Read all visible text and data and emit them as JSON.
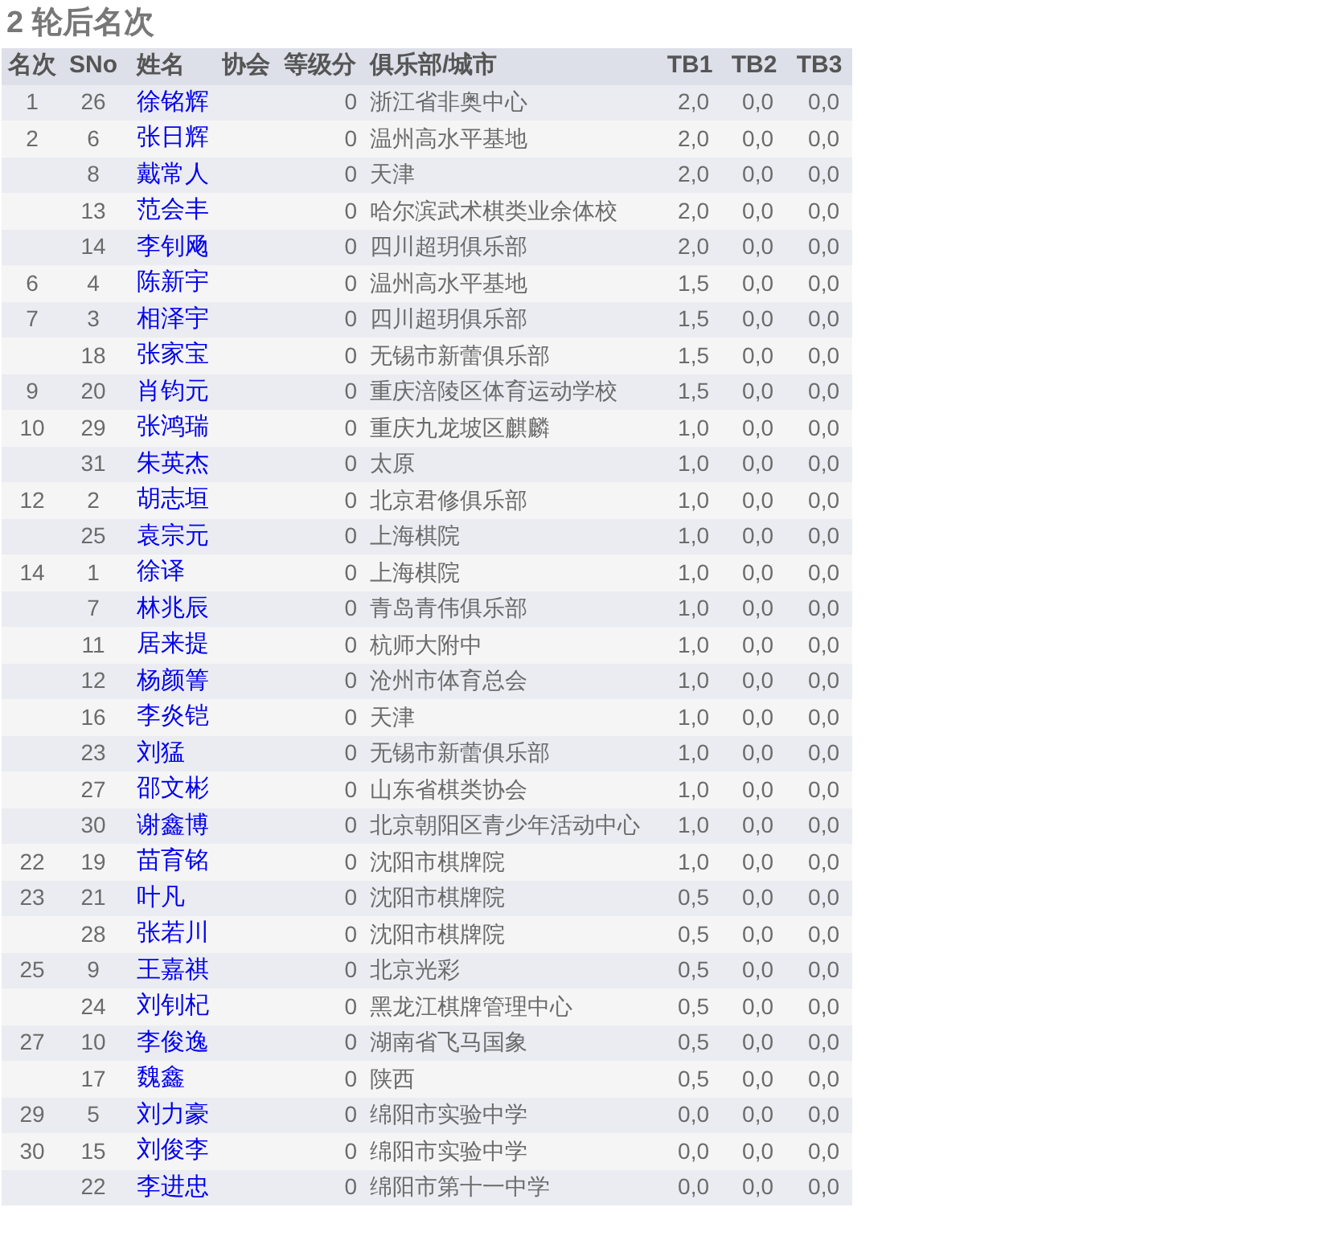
{
  "title": "2 轮后名次",
  "columns": [
    "名次",
    "SNo",
    "姓名",
    "协会",
    "等级分",
    "俱乐部/城市",
    "TB1",
    "TB2",
    "TB3"
  ],
  "rows": [
    {
      "rank": "1",
      "sno": "26",
      "name": "徐铭辉",
      "rating": "0",
      "club": "浙江省非奥中心",
      "tb1": "2,0",
      "tb2": "0,0",
      "tb3": "0,0"
    },
    {
      "rank": "2",
      "sno": "6",
      "name": "张日辉",
      "rating": "0",
      "club": "温州高水平基地",
      "tb1": "2,0",
      "tb2": "0,0",
      "tb3": "0,0"
    },
    {
      "sno": "8",
      "name": "戴常人",
      "rating": "0",
      "club": "天津",
      "tb1": "2,0",
      "tb2": "0,0",
      "tb3": "0,0"
    },
    {
      "sno": "13",
      "name": "范会丰",
      "rating": "0",
      "club": "哈尔滨武术棋类业余体校",
      "tb1": "2,0",
      "tb2": "0,0",
      "tb3": "0,0"
    },
    {
      "sno": "14",
      "name": "李钊飏",
      "rating": "0",
      "club": "四川超玥俱乐部",
      "tb1": "2,0",
      "tb2": "0,0",
      "tb3": "0,0"
    },
    {
      "rank": "6",
      "sno": "4",
      "name": "陈新宇",
      "rating": "0",
      "club": "温州高水平基地",
      "tb1": "1,5",
      "tb2": "0,0",
      "tb3": "0,0"
    },
    {
      "rank": "7",
      "sno": "3",
      "name": "相泽宇",
      "rating": "0",
      "club": "四川超玥俱乐部",
      "tb1": "1,5",
      "tb2": "0,0",
      "tb3": "0,0"
    },
    {
      "sno": "18",
      "name": "张家宝",
      "rating": "0",
      "club": "无锡市新蕾俱乐部",
      "tb1": "1,5",
      "tb2": "0,0",
      "tb3": "0,0"
    },
    {
      "rank": "9",
      "sno": "20",
      "name": "肖钧元",
      "rating": "0",
      "club": "重庆涪陵区体育运动学校",
      "tb1": "1,5",
      "tb2": "0,0",
      "tb3": "0,0"
    },
    {
      "rank": "10",
      "sno": "29",
      "name": "张鸿瑞",
      "rating": "0",
      "club": "重庆九龙坡区麒麟",
      "tb1": "1,0",
      "tb2": "0,0",
      "tb3": "0,0"
    },
    {
      "sno": "31",
      "name": "朱英杰",
      "rating": "0",
      "club": "太原",
      "tb1": "1,0",
      "tb2": "0,0",
      "tb3": "0,0"
    },
    {
      "rank": "12",
      "sno": "2",
      "name": "胡志垣",
      "rating": "0",
      "club": "北京君修俱乐部",
      "tb1": "1,0",
      "tb2": "0,0",
      "tb3": "0,0"
    },
    {
      "sno": "25",
      "name": "袁宗元",
      "rating": "0",
      "club": "上海棋院",
      "tb1": "1,0",
      "tb2": "0,0",
      "tb3": "0,0"
    },
    {
      "rank": "14",
      "sno": "1",
      "name": "徐译",
      "rating": "0",
      "club": "上海棋院",
      "tb1": "1,0",
      "tb2": "0,0",
      "tb3": "0,0"
    },
    {
      "sno": "7",
      "name": "林兆辰",
      "rating": "0",
      "club": "青岛青伟俱乐部",
      "tb1": "1,0",
      "tb2": "0,0",
      "tb3": "0,0"
    },
    {
      "sno": "11",
      "name": "居来提",
      "rating": "0",
      "club": "杭师大附中",
      "tb1": "1,0",
      "tb2": "0,0",
      "tb3": "0,0"
    },
    {
      "sno": "12",
      "name": "杨颜箐",
      "rating": "0",
      "club": "沧州市体育总会",
      "tb1": "1,0",
      "tb2": "0,0",
      "tb3": "0,0"
    },
    {
      "sno": "16",
      "name": "李炎铠",
      "rating": "0",
      "club": "天津",
      "tb1": "1,0",
      "tb2": "0,0",
      "tb3": "0,0"
    },
    {
      "sno": "23",
      "name": "刘猛",
      "rating": "0",
      "club": "无锡市新蕾俱乐部",
      "tb1": "1,0",
      "tb2": "0,0",
      "tb3": "0,0"
    },
    {
      "sno": "27",
      "name": "邵文彬",
      "rating": "0",
      "club": "山东省棋类协会",
      "tb1": "1,0",
      "tb2": "0,0",
      "tb3": "0,0"
    },
    {
      "sno": "30",
      "name": "谢鑫博",
      "rating": "0",
      "club": "北京朝阳区青少年活动中心",
      "tb1": "1,0",
      "tb2": "0,0",
      "tb3": "0,0"
    },
    {
      "rank": "22",
      "sno": "19",
      "name": "苗育铭",
      "rating": "0",
      "club": "沈阳市棋牌院",
      "tb1": "1,0",
      "tb2": "0,0",
      "tb3": "0,0"
    },
    {
      "rank": "23",
      "sno": "21",
      "name": "叶凡",
      "rating": "0",
      "club": "沈阳市棋牌院",
      "tb1": "0,5",
      "tb2": "0,0",
      "tb3": "0,0"
    },
    {
      "sno": "28",
      "name": "张若川",
      "rating": "0",
      "club": "沈阳市棋牌院",
      "tb1": "0,5",
      "tb2": "0,0",
      "tb3": "0,0"
    },
    {
      "rank": "25",
      "sno": "9",
      "name": "王嘉祺",
      "rating": "0",
      "club": "北京光彩",
      "tb1": "0,5",
      "tb2": "0,0",
      "tb3": "0,0"
    },
    {
      "sno": "24",
      "name": "刘钊杞",
      "rating": "0",
      "club": "黑龙江棋牌管理中心",
      "tb1": "0,5",
      "tb2": "0,0",
      "tb3": "0,0"
    },
    {
      "rank": "27",
      "sno": "10",
      "name": "李俊逸",
      "rating": "0",
      "club": "湖南省飞马国象",
      "tb1": "0,5",
      "tb2": "0,0",
      "tb3": "0,0"
    },
    {
      "sno": "17",
      "name": "魏鑫",
      "rating": "0",
      "club": "陕西",
      "tb1": "0,5",
      "tb2": "0,0",
      "tb3": "0,0"
    },
    {
      "rank": "29",
      "sno": "5",
      "name": "刘力豪",
      "rating": "0",
      "club": "绵阳市实验中学",
      "tb1": "0,0",
      "tb2": "0,0",
      "tb3": "0,0"
    },
    {
      "rank": "30",
      "sno": "15",
      "name": "刘俊李",
      "rating": "0",
      "club": "绵阳市实验中学",
      "tb1": "0,0",
      "tb2": "0,0",
      "tb3": "0,0"
    },
    {
      "sno": "22",
      "name": "李进忠",
      "rating": "0",
      "club": "绵阳市第十一中学",
      "tb1": "0,0",
      "tb2": "0,0",
      "tb3": "0,0"
    }
  ]
}
